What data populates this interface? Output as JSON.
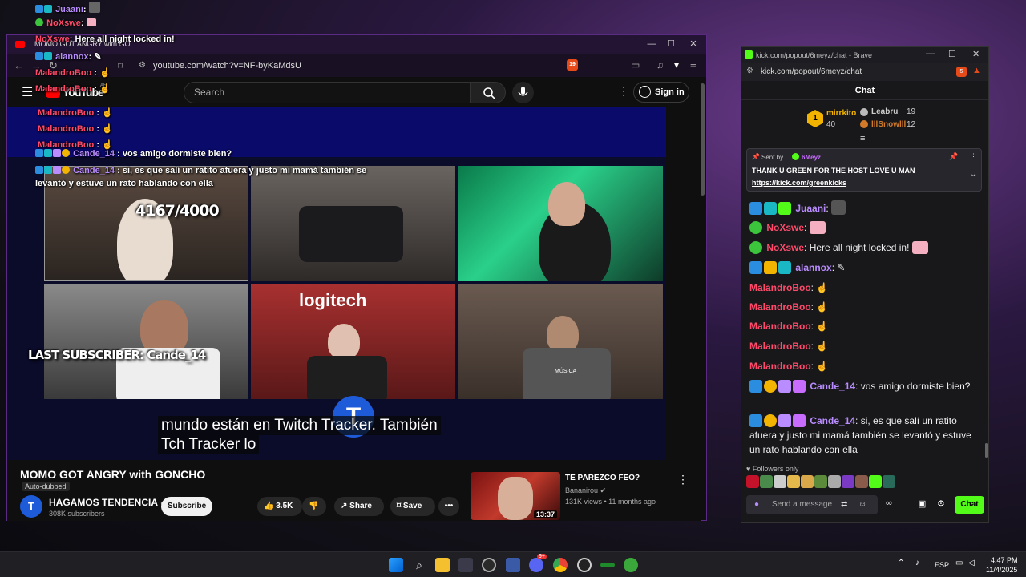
{
  "overlay_chat": {
    "lines": [
      {
        "name": "Juaani",
        "text": ""
      },
      {
        "name": "NoXswe",
        "text": ""
      },
      {
        "name": "NoXswe",
        "text": "Here all night locked in!"
      },
      {
        "name": "alannox",
        "text": ""
      },
      {
        "name": "MalandroBoo",
        "text": ""
      },
      {
        "name": "MalandroBoo",
        "text": ""
      },
      {
        "name": "MalandroBoo",
        "text": ""
      },
      {
        "name": "MalandroBoo",
        "text": ""
      },
      {
        "name": "MalandroBoo",
        "text": ""
      },
      {
        "name": "Cande_14",
        "text": "vos amigo dormiste bien?"
      },
      {
        "name": "Cande_14",
        "text": "si, es que salí un ratito afuera y justo mi mamá también se"
      },
      {
        "name": "",
        "text": "levantó y estuve un rato hablando con ella"
      }
    ]
  },
  "youtube": {
    "tab_title": "MOMO GOT ANGRY with GO",
    "url": "youtube.com/watch?v=NF-byKaMdsU",
    "brave_badge": "19",
    "logo": "YouTube",
    "logo_region": "AR",
    "search_placeholder": "Search",
    "sign_in": "Sign in",
    "video": {
      "counter": "4167/4000",
      "last_sub": "LAST SUBSCRIBER: Cande_14",
      "logo_text": "logitech",
      "shirt_text": "MÚSICA",
      "watermark": "T",
      "subtitle_line1": "mundo están en Twitch Tracker. También",
      "subtitle_line2": "Tch Tracker lo"
    },
    "title": "MOMO GOT ANGRY with GONCHO",
    "auto_dubbed": "Auto-dubbed",
    "channel": {
      "name": "HAGAMOS TENDENCIA",
      "subs": "308K subscribers",
      "avatar": "T"
    },
    "subscribe": "Subscribe",
    "likes": "3.5K",
    "share": "Share",
    "save": "Save",
    "more": "•••",
    "recommended": {
      "title": "TE PAREZCO FEO?",
      "channel": "Bananirou",
      "meta": "131K views • 11 months ago",
      "duration": "13:37"
    }
  },
  "kick": {
    "window_title": "kick.com/popout/6meyz/chat - Brave",
    "url": "kick.com/popout/6meyz/chat",
    "brave_badge": "5",
    "header": "Chat",
    "leaderboard": {
      "top": {
        "name": "mirrkito",
        "count": "40",
        "rank": "1"
      },
      "second": {
        "name": "Leabru",
        "count": "19"
      },
      "third": {
        "name": "lllSnowlll",
        "count": "12"
      }
    },
    "pinned": {
      "sent_by": "Sent by",
      "sender": "6Meyz",
      "message": "THANK U GREEN FOR THE HOST LOVE U MAN",
      "link": "https://kick.com/greenkicks"
    },
    "messages": [
      {
        "name": "Juaani",
        "text": "",
        "color": "#b98cff"
      },
      {
        "name": "NoXswe",
        "text": "",
        "color": "#ff4a6a"
      },
      {
        "name": "NoXswe",
        "text": "Here all night locked in!",
        "color": "#ff4a6a"
      },
      {
        "name": "alannox",
        "text": "",
        "color": "#b98cff"
      },
      {
        "name": "MalandroBoo",
        "text": "",
        "color": "#ff4a6a"
      },
      {
        "name": "MalandroBoo",
        "text": "",
        "color": "#ff4a6a"
      },
      {
        "name": "MalandroBoo",
        "text": "",
        "color": "#ff4a6a"
      },
      {
        "name": "MalandroBoo",
        "text": "",
        "color": "#ff4a6a"
      },
      {
        "name": "MalandroBoo",
        "text": "",
        "color": "#ff4a6a"
      },
      {
        "name": "Cande_14",
        "text": "vos amigo dormiste bien?",
        "color": "#b98cff"
      },
      {
        "name": "Cande_14",
        "text": "si, es que salí un ratito afuera y justo mi mamá también se levantó y estuve un rato hablando con ella",
        "color": "#b98cff"
      }
    ],
    "followers_only": "Followers only",
    "input_placeholder": "Send a message",
    "send": "Chat"
  },
  "taskbar": {
    "lang": "ESP",
    "time": "4:47 PM",
    "date": "11/4/2025",
    "discord_badge": "9+"
  },
  "colors": {
    "kick_green": "#53fc18",
    "name_red": "#ff4a6a",
    "name_purple": "#b98cff",
    "yt_bg": "#0f0f0f"
  }
}
